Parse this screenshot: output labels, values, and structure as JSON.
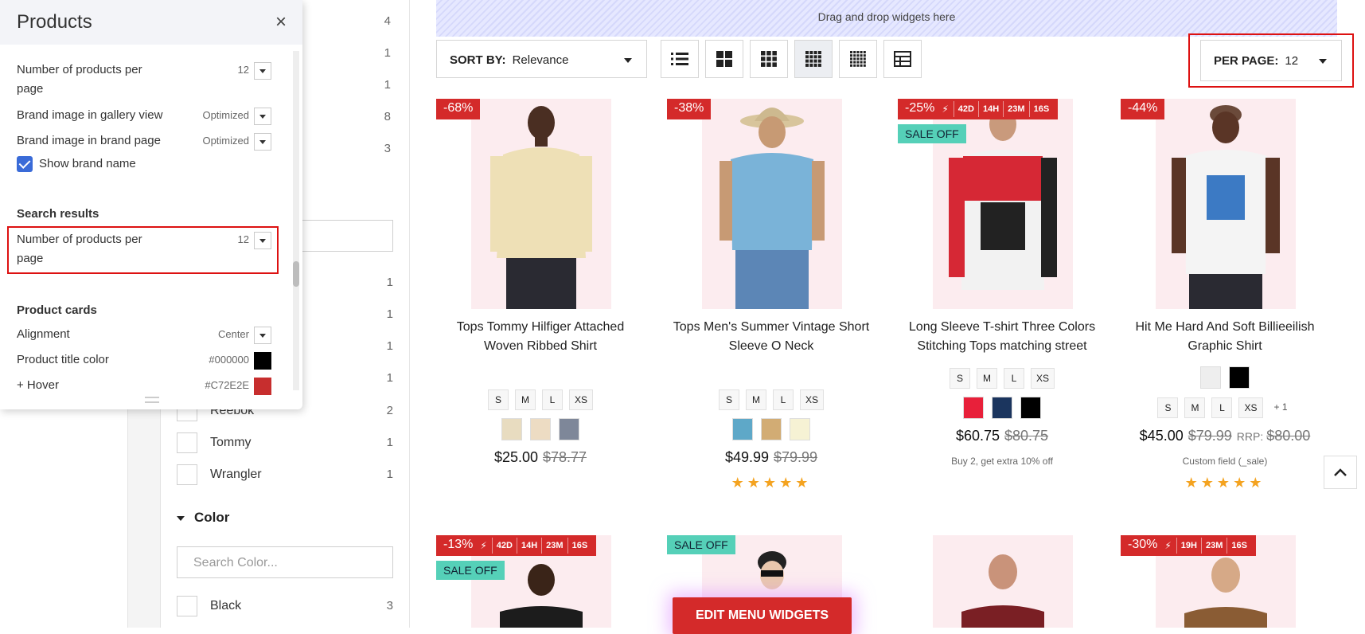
{
  "filters": {
    "top_counts": [
      "4",
      "1",
      "1",
      "8",
      "3"
    ],
    "brand_items": [
      {
        "label": "",
        "count": "1"
      },
      {
        "label": "",
        "count": "1"
      },
      {
        "label": "",
        "count": "1"
      },
      {
        "label": "",
        "count": "1"
      },
      {
        "label": "Reebok",
        "count": "2"
      },
      {
        "label": "Tommy",
        "count": "1"
      },
      {
        "label": "Wrangler",
        "count": "1"
      }
    ],
    "color_section": {
      "title": "Color",
      "search_placeholder": "Search Color...",
      "items": [
        {
          "label": "Black",
          "count": "3"
        }
      ]
    }
  },
  "panel": {
    "title": "Products",
    "close_icon": "×",
    "rows": {
      "products_per_page_1": {
        "label": "Number of products per page",
        "value": "12"
      },
      "brand_img_gallery": {
        "label": "Brand image in gallery view",
        "value": "Optimized"
      },
      "brand_img_page": {
        "label": "Brand image in brand page",
        "value": "Optimized"
      },
      "show_brand_name": {
        "label": "Show brand name",
        "checked": true
      }
    },
    "search_results": {
      "heading": "Search results",
      "products_per_page": {
        "label": "Number of products per page",
        "value": "12"
      }
    },
    "product_cards": {
      "heading": "Product cards",
      "alignment": {
        "label": "Alignment",
        "value": "Center"
      },
      "title_color": {
        "label": "Product title color",
        "value": "#000000",
        "swatch": "#000000"
      },
      "hover": {
        "label": "+ Hover",
        "value": "#C72E2E",
        "swatch": "#C72E2E"
      }
    }
  },
  "toolbar": {
    "dropzone": "Drag and drop widgets here",
    "sort_label": "SORT BY:",
    "sort_value": "Relevance",
    "per_page_label": "PER PAGE:",
    "per_page_value": "12",
    "view_icons": [
      "list-view-icon",
      "grid-2-icon",
      "grid-3-icon",
      "grid-4-icon",
      "grid-5-icon",
      "table-view-icon"
    ]
  },
  "products": [
    {
      "discount": "-68%",
      "title": "Tops Tommy Hilfiger Attached Woven Ribbed Shirt",
      "sizes": [
        "S",
        "M",
        "L",
        "XS"
      ],
      "colors": [
        "#e8dcc0",
        "#eddcc3",
        "#7e8799"
      ],
      "price": "$25.00",
      "old_price": "$78.77",
      "shirt_color": "#eee0b6"
    },
    {
      "discount": "-38%",
      "title": "Tops Men's Summer Vintage Short Sleeve O Neck",
      "sizes": [
        "S",
        "M",
        "L",
        "XS"
      ],
      "colors": [
        "#5ea8c8",
        "#d2ac74",
        "#f6f2d4"
      ],
      "price": "$49.99",
      "old_price": "$79.99",
      "stars": "★★★★★",
      "shirt_color": "#7ab3d8"
    },
    {
      "discount": "-25%",
      "timer": {
        "days": "42D",
        "hours": "14H",
        "minutes": "23M",
        "seconds": "16S"
      },
      "sale_off": "SALE OFF",
      "title": "Long Sleeve T-shirt Three Colors Stitching Tops matching street",
      "sizes": [
        "S",
        "M",
        "L",
        "XS"
      ],
      "colors": [
        "#e8203a",
        "#1b355e",
        "#000000"
      ],
      "price": "$60.75",
      "old_price": "$80.75",
      "note": "Buy 2, get extra 10% off",
      "shirt_color": "#d62835"
    },
    {
      "discount": "-44%",
      "title": "Hit Me Hard And Soft Billieeilish Graphic Shirt",
      "colors_top": [
        "#eeeeee",
        "#000000"
      ],
      "sizes": [
        "S",
        "M",
        "L",
        "XS"
      ],
      "sizes_more": "+ 1",
      "price": "$45.00",
      "old_price": "$79.99",
      "rrp_label": "RRP:",
      "rrp_price": "$80.00",
      "note": "Custom field (_sale)",
      "stars": "★★★★★",
      "shirt_color": "#f4f4f4"
    }
  ],
  "products_row2": [
    {
      "discount": "-13%",
      "timer": {
        "days": "42D",
        "hours": "14H",
        "minutes": "23M",
        "seconds": "16S"
      },
      "sale_off": "SALE OFF"
    },
    {
      "sale_off": "SALE OFF"
    },
    {},
    {
      "discount": "-30%",
      "timer": {
        "hours": "19H",
        "minutes": "23M",
        "seconds": "16S"
      }
    }
  ],
  "edit_widgets": "EDIT MENU WIDGETS"
}
